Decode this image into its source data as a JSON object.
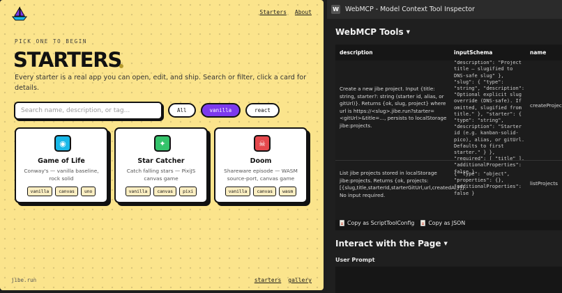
{
  "site": {
    "nav": {
      "starters": "Starters",
      "about": "About"
    },
    "eyebrow": "PICK ONE TO BEGIN",
    "title": "STARTERS",
    "subtitle": "Every starter is a real app you can open, edit, and ship. Search or filter, click a card for details.",
    "search_placeholder": "Search name, description, or tag...",
    "filters": [
      "All",
      "vanilla",
      "react"
    ],
    "active_filter": "vanilla",
    "cards": [
      {
        "name": "Game of Life",
        "desc": "Conway's — vanilla baseline, rock solid",
        "tags": [
          "vanilla",
          "canvas",
          "uno"
        ],
        "icon": "game-of-life-icon",
        "icon_color": "#19b8e8",
        "glyph": "◉"
      },
      {
        "name": "Star Catcher",
        "desc": "Catch falling stars — PixiJS canvas game",
        "tags": [
          "vanilla",
          "canvas",
          "pixi"
        ],
        "icon": "star-icon",
        "icon_color": "#34c36b",
        "glyph": "✦"
      },
      {
        "name": "Doom",
        "desc": "Shareware episode — WASM source-port, canvas game",
        "tags": [
          "vanilla",
          "canvas",
          "wasm"
        ],
        "icon": "skull-icon",
        "icon_color": "#e5484d",
        "glyph": "☠"
      }
    ],
    "footer": {
      "brand": "jibe.run",
      "links": [
        "starters",
        "gallery"
      ]
    },
    "colors": {
      "background": "#fbe48c",
      "accent": "#7c3aed"
    }
  },
  "inspector": {
    "window_title": "WebMCP - Model Context Tool Inspector",
    "app_icon_letter": "W",
    "tools_title": "WebMCP Tools",
    "columns": [
      "description",
      "inputSchema",
      "name"
    ],
    "rows": [
      {
        "description": "Create a new jibe project. Input {title: string, starter?: string (starter id, alias, or gitUrl)}. Returns {ok, slug, project} where url is https://<slug>.jibe.run?starter=<gitUrl>&title=..., persists to localStorage jibe:projects.",
        "schema": "{ \"type\": \"string\",\n\"description\": \"Project\ntitle — slugified to\nDNS-safe slug\" },\n\"slug\": { \"type\":\n\"string\", \"description\":\n\"Optional explicit slug\noverride (DNS-safe). If\nomitted, slugified from\ntitle.\" }, \"starter\": {\n\"type\": \"string\",\n\"description\": \"Starter\nid (e.g. kanban-solid-\npico), alias, or gitUrl.\nDefaults to first\nstarter.\" } },\n\"required\": [ \"title\" ],\n\"additionalProperties\":\nfalse }",
        "name": "createProject"
      },
      {
        "description": "List jibe projects stored in localStorage jibe:projects. Returns {ok, projects: [{slug,title,starterId,starterGitUrl,url,createdAt}]}. No input required.",
        "schema": "{ \"type\": \"object\",\n\"properties\": {},\n\"additionalProperties\":\nfalse }",
        "name": "listProjects"
      }
    ],
    "copy_buttons": [
      "Copy as ScriptToolConfig",
      "Copy as JSON"
    ],
    "interact_title": "Interact with the Page",
    "prompt_label": "User Prompt"
  }
}
